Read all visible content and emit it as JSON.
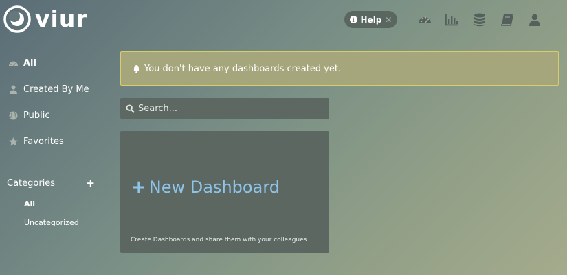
{
  "brand": {
    "name": "viur"
  },
  "header": {
    "help_label": "Help",
    "help_close": "✕",
    "icons": [
      "dashboard-icon",
      "bar-chart-icon",
      "database-icon",
      "book-icon",
      "user-icon"
    ]
  },
  "sidebar": {
    "items": [
      {
        "label": "All",
        "icon": "dashboard-icon",
        "active": true
      },
      {
        "label": "Created By Me",
        "icon": "user-icon",
        "active": false
      },
      {
        "label": "Public",
        "icon": "globe-icon",
        "active": false
      },
      {
        "label": "Favorites",
        "icon": "star-icon",
        "active": false
      }
    ],
    "categories_label": "Categories",
    "categories_add": "+",
    "categories": [
      {
        "label": "All",
        "active": true
      },
      {
        "label": "Uncategorized",
        "active": false
      }
    ]
  },
  "main": {
    "alert_text": "You don't have any dashboards created yet.",
    "search_placeholder": "Search...",
    "search_value": "",
    "new_dashboard_label": "New Dashboard",
    "new_dashboard_plus": "+",
    "new_dashboard_hint": "Create Dashboards and share them with your colleagues"
  },
  "colors": {
    "accent": "#8ec4e8",
    "alert_border": "#d9cc6a",
    "panel": "#5c6762"
  }
}
